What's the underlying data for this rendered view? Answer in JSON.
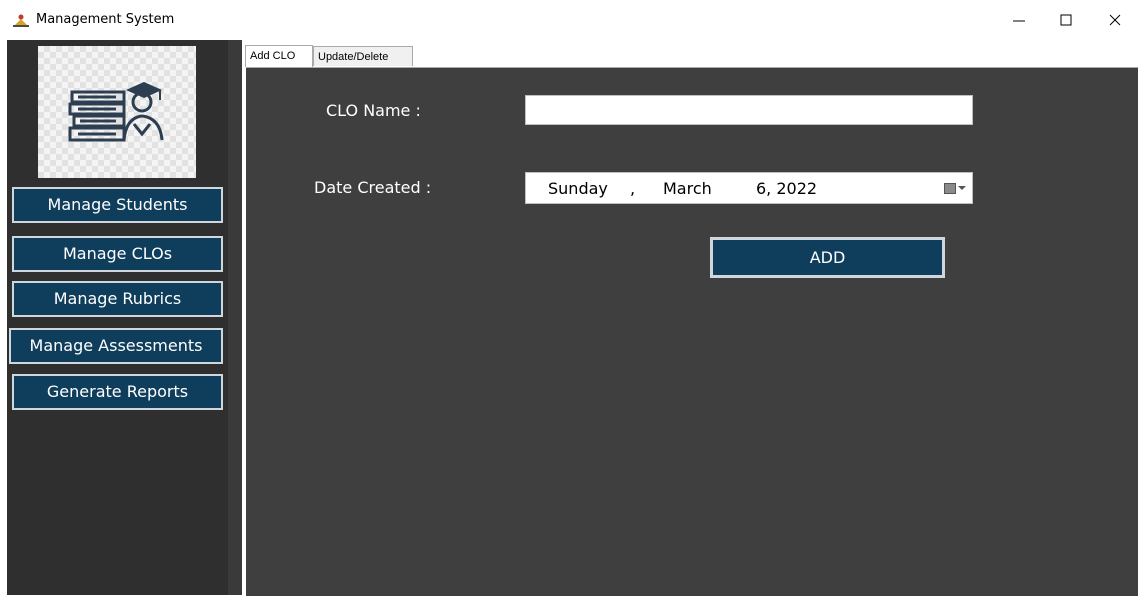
{
  "window": {
    "title": "Management System"
  },
  "sidebar": {
    "items": [
      {
        "label": "Manage Students"
      },
      {
        "label": "Manage CLOs"
      },
      {
        "label": "Manage Rubrics"
      },
      {
        "label": "Manage Assessments"
      },
      {
        "label": "Generate Reports"
      }
    ]
  },
  "tabs": {
    "add_clo": "Add CLO",
    "update_delete": "Update/Delete",
    "active": "Add CLO"
  },
  "form": {
    "clo_name_label": "CLO Name :",
    "clo_name_value": "",
    "date_label": "Date Created :",
    "date": {
      "weekday": "Sunday",
      "sep": ",",
      "month": "March",
      "day_year": "6, 2022"
    },
    "add_label": "ADD"
  },
  "colors": {
    "panel": "#3f3f3f",
    "sidebar": "#2f2f2f",
    "button": "#0f3d5c",
    "button_border": "#cfd6dc"
  }
}
